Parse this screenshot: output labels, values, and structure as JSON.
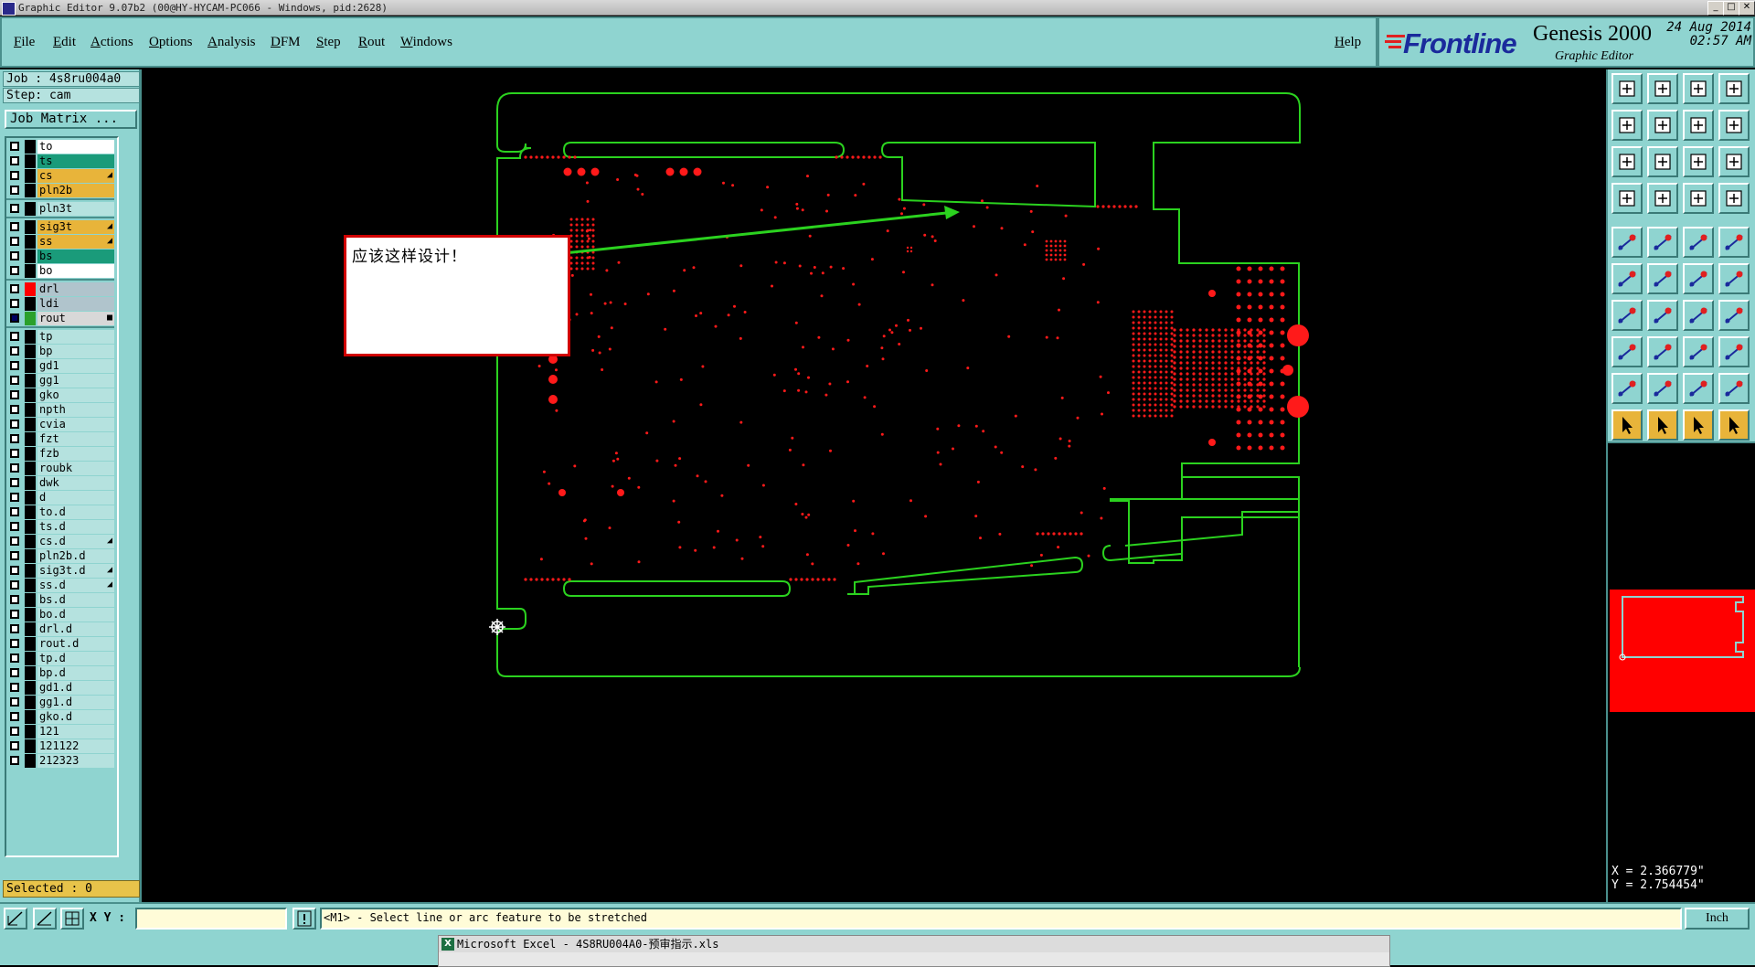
{
  "window": {
    "title": "Graphic Editor 9.07b2 (00@HY-HYCAM-PC066 - Windows, pid:2628)",
    "buttons": [
      "_",
      "□",
      "✕"
    ]
  },
  "menu": [
    "File",
    "Edit",
    "Actions",
    "Options",
    "Analysis",
    "DFM",
    "Step",
    "Rout",
    "Windows"
  ],
  "help_label": "Help",
  "brand": {
    "logo_text": "Frontline",
    "product": "Genesis 2000",
    "subtitle": "Graphic Editor",
    "date": "24 Aug 2014",
    "time": "02:57 AM"
  },
  "job": {
    "job_label": "Job : 4s8ru004a0",
    "step_label": "Step: cam",
    "job_matrix_label": "Job Matrix ..."
  },
  "layers": [
    {
      "name": "to",
      "bg": "#ffffff",
      "color": "#000000",
      "mark": ""
    },
    {
      "name": "ts",
      "bg": "#1a9b7a",
      "color": "#000000",
      "mark": ""
    },
    {
      "name": "cs",
      "bg": "#e8b43a",
      "color": "#000000",
      "mark": "◢"
    },
    {
      "name": "pln2b",
      "bg": "#e8b43a",
      "color": "#000000",
      "mark": ""
    },
    {
      "name": "pln3t",
      "bg": "#b5e2df",
      "color": "#000000",
      "mark": "",
      "gap": true
    },
    {
      "name": "sig3t",
      "bg": "#e8b43a",
      "color": "#000000",
      "mark": "◢",
      "gap": true
    },
    {
      "name": "ss",
      "bg": "#e8b43a",
      "color": "#000000",
      "mark": "◢"
    },
    {
      "name": "bs",
      "bg": "#1a9b7a",
      "color": "#000000",
      "mark": ""
    },
    {
      "name": "bo",
      "bg": "#ffffff",
      "color": "#000000",
      "mark": ""
    },
    {
      "name": "drl",
      "bg": "#b0c4cc",
      "color": "#ff0000",
      "mark": "",
      "gap": true
    },
    {
      "name": "ldi",
      "bg": "#b0c4cc",
      "color": "#000000",
      "mark": ""
    },
    {
      "name": "rout",
      "bg": "#d8d8d8",
      "color": "#2aa02a",
      "mark": "■",
      "selected": true
    },
    {
      "name": "tp",
      "bg": "#b5e2df",
      "color": "#000000",
      "mark": "",
      "gap": true
    },
    {
      "name": "bp",
      "bg": "#b5e2df",
      "color": "#000000",
      "mark": ""
    },
    {
      "name": "gd1",
      "bg": "#b5e2df",
      "color": "#000000",
      "mark": ""
    },
    {
      "name": "gg1",
      "bg": "#b5e2df",
      "color": "#000000",
      "mark": ""
    },
    {
      "name": "gko",
      "bg": "#b5e2df",
      "color": "#000000",
      "mark": ""
    },
    {
      "name": "npth",
      "bg": "#b5e2df",
      "color": "#000000",
      "mark": ""
    },
    {
      "name": "cvia",
      "bg": "#b5e2df",
      "color": "#000000",
      "mark": ""
    },
    {
      "name": "fzt",
      "bg": "#b5e2df",
      "color": "#000000",
      "mark": ""
    },
    {
      "name": "fzb",
      "bg": "#b5e2df",
      "color": "#000000",
      "mark": ""
    },
    {
      "name": "roubk",
      "bg": "#b5e2df",
      "color": "#000000",
      "mark": ""
    },
    {
      "name": "dwk",
      "bg": "#b5e2df",
      "color": "#000000",
      "mark": ""
    },
    {
      "name": "d",
      "bg": "#b5e2df",
      "color": "#000000",
      "mark": ""
    },
    {
      "name": "to.d",
      "bg": "#b5e2df",
      "color": "#000000",
      "mark": ""
    },
    {
      "name": "ts.d",
      "bg": "#b5e2df",
      "color": "#000000",
      "mark": ""
    },
    {
      "name": "cs.d",
      "bg": "#b5e2df",
      "color": "#000000",
      "mark": "◢"
    },
    {
      "name": "pln2b.d",
      "bg": "#b5e2df",
      "color": "#000000",
      "mark": ""
    },
    {
      "name": "sig3t.d",
      "bg": "#b5e2df",
      "color": "#000000",
      "mark": "◢"
    },
    {
      "name": "ss.d",
      "bg": "#b5e2df",
      "color": "#000000",
      "mark": "◢"
    },
    {
      "name": "bs.d",
      "bg": "#b5e2df",
      "color": "#000000",
      "mark": ""
    },
    {
      "name": "bo.d",
      "bg": "#b5e2df",
      "color": "#000000",
      "mark": ""
    },
    {
      "name": "drl.d",
      "bg": "#b5e2df",
      "color": "#000000",
      "mark": ""
    },
    {
      "name": "rout.d",
      "bg": "#b5e2df",
      "color": "#000000",
      "mark": ""
    },
    {
      "name": "tp.d",
      "bg": "#b5e2df",
      "color": "#000000",
      "mark": ""
    },
    {
      "name": "bp.d",
      "bg": "#b5e2df",
      "color": "#000000",
      "mark": ""
    },
    {
      "name": "gd1.d",
      "bg": "#b5e2df",
      "color": "#000000",
      "mark": ""
    },
    {
      "name": "gg1.d",
      "bg": "#b5e2df",
      "color": "#000000",
      "mark": ""
    },
    {
      "name": "gko.d",
      "bg": "#b5e2df",
      "color": "#000000",
      "mark": ""
    },
    {
      "name": "121",
      "bg": "#b5e2df",
      "color": "#000000",
      "mark": ""
    },
    {
      "name": "121122",
      "bg": "#b5e2df",
      "color": "#000000",
      "mark": ""
    },
    {
      "name": "212323",
      "bg": "#b5e2df",
      "color": "#000000",
      "mark": ""
    }
  ],
  "selected_label": "Selected : 0",
  "annotation_text": "应该这样设计！",
  "coords": {
    "x": "X = 2.366779\"",
    "y": "Y = 2.754454\""
  },
  "status": {
    "xy_label": "X Y :",
    "xy_value": "",
    "message": "<M1> - Select line or arc feature to be stretched",
    "units": "Inch"
  },
  "taskbar": {
    "excel_title": "Microsoft Excel - 4S8RU004A0-预审指示.xls"
  },
  "tool_icons": [
    "open-job-icon",
    "save-job-icon",
    "home-icon",
    "split-window-icon",
    "zoom-prev-icon",
    "zoom-next-icon",
    "zoom-fit-icon",
    "redraw-icon",
    "zoom-home-icon",
    "zoom-in-out-icon",
    "scale-1-2-icon",
    "help-icon",
    "measure-icon",
    "grid-icon",
    "snap-icon",
    "drc-icon",
    "pad-icon",
    "resize-icon",
    "ruler-icon",
    "surface-icon",
    "node-icon",
    "stretch-icon",
    "connect-icon",
    "move-node-icon",
    "line-icon",
    "draw-line-icon",
    "arc-icon",
    "copy-icon",
    "pad-edit-icon",
    "dash-line-icon",
    "center-line-icon",
    "shape-icon",
    "angle-icon",
    "triangle-icon",
    "polygon-icon",
    "trapezoid-icon",
    "select-icon",
    "select-add-icon",
    "select-remove-icon",
    "select-net-icon"
  ]
}
